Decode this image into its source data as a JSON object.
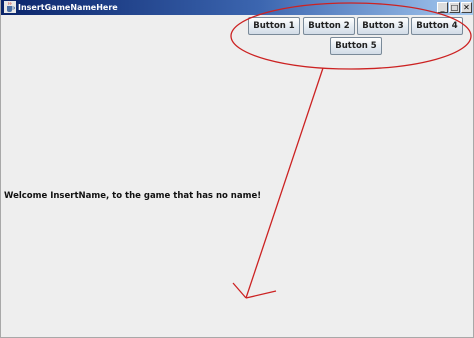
{
  "window": {
    "title": "InsertGameNameHere",
    "controls": {
      "minimize_glyph": "_",
      "maximize_glyph": "□",
      "close_glyph": "✕"
    }
  },
  "content": {
    "buttons": [
      {
        "label": "Button 1"
      },
      {
        "label": "Button 2"
      },
      {
        "label": "Button 3"
      },
      {
        "label": "Button 4"
      },
      {
        "label": "Button 5"
      }
    ],
    "welcome_text": "Welcome InsertName, to the game that has no name!"
  },
  "colors": {
    "annotation": "#cc2222",
    "title_bar_start": "#0a246a",
    "title_bar_end": "#a6caf0",
    "background": "#eeeeee"
  },
  "icons": {
    "app": "java-coffee-cup-icon"
  }
}
